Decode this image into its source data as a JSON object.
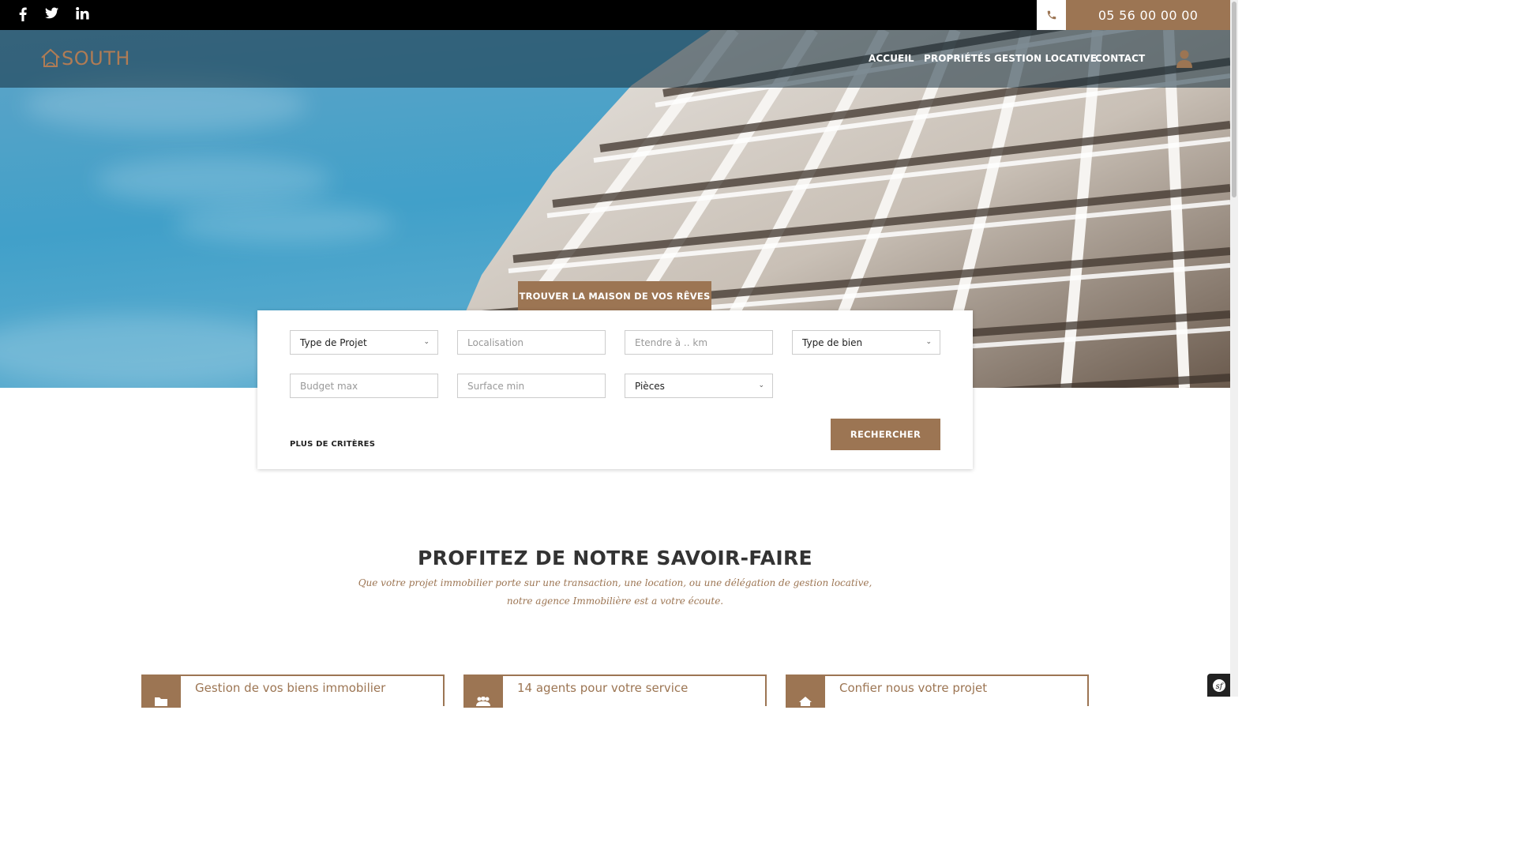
{
  "topbar": {
    "social": [
      {
        "name": "facebook-icon",
        "glyph": "f"
      },
      {
        "name": "twitter-icon",
        "glyph": "twitter"
      },
      {
        "name": "linkedin-icon",
        "glyph": "in"
      }
    ],
    "phone": "05 56 00 00 00"
  },
  "brand": {
    "name": "SOUTH",
    "color": "#b07c55"
  },
  "nav": {
    "items": [
      "ACCUEIL",
      "PROPRIÉTÉS",
      "GESTION LOCATIVE",
      "CONTACT"
    ]
  },
  "search": {
    "tab_label": "TROUVER LA MAISON DE VOS RÊVES",
    "project_type": "Type de Projet",
    "location_placeholder": "Localisation",
    "extend_placeholder": "Etendre à .. km",
    "property_type": "Type de bien",
    "budget_placeholder": "Budget max",
    "surface_placeholder": "Surface min",
    "rooms": "Pièces",
    "more_criteria": "PLUS DE CRITÈRES",
    "submit_label": "RECHERCHER"
  },
  "section": {
    "title": "PROFITEZ DE NOTRE SAVOIR-FAIRE",
    "subtitle_line1": "Que votre projet immobilier porte sur une transaction, une location, ou une délégation de gestion locative,",
    "subtitle_line2": "notre agence Immobilière est a votre écoute."
  },
  "features": [
    {
      "label": "Gestion de vos biens immobilier",
      "icon": "folder-icon"
    },
    {
      "label": "14 agents pour votre service",
      "icon": "users-icon"
    },
    {
      "label": "Confier nous votre projet",
      "icon": "home-icon"
    }
  ],
  "colors": {
    "accent": "#9c7553",
    "topbar": "#000000",
    "sky": "#41a0c9"
  }
}
